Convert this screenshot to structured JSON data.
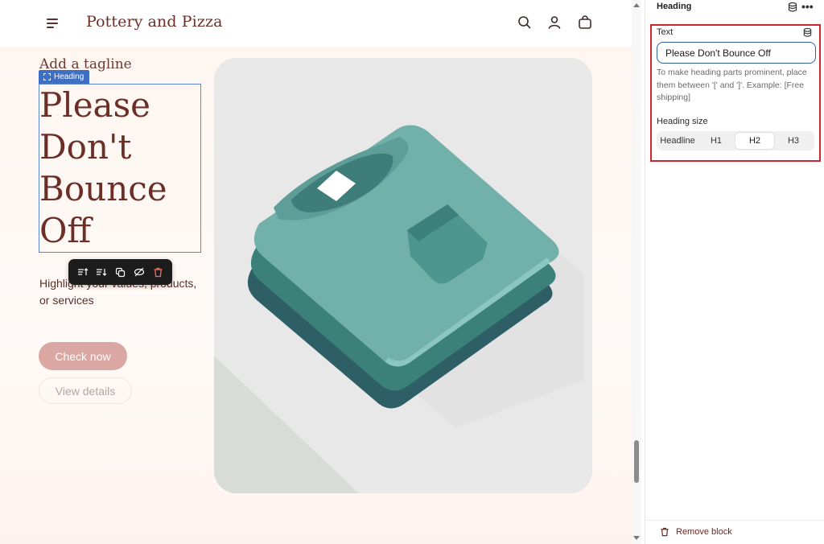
{
  "store": {
    "name": "Pottery and Pizza"
  },
  "hero": {
    "tagline": "Add a tagline",
    "heading_chip": "Heading",
    "heading": "Please Don't Bounce Off",
    "subtext": "Highlight your values, products, or services",
    "primary_button": "Check now",
    "secondary_button": "View details"
  },
  "panel": {
    "title": "Heading",
    "text_label": "Text",
    "text_value": "Please Don't Bounce Off",
    "help": "To make heading parts prominent, place them between '[' and ']'. Example: [Free shipping]",
    "size_label": "Heading size",
    "sizes": [
      "Headline",
      "H1",
      "H2",
      "H3"
    ],
    "active_size": "H2",
    "remove": "Remove block"
  },
  "colors": {
    "brand": "#6b2f28",
    "primary_button": "#dba7a2",
    "chip": "#3f6fc4",
    "highlight": "#c9262f",
    "shirt": "#72b0aa"
  },
  "icons": [
    "menu-icon",
    "search-icon",
    "account-icon",
    "cart-icon",
    "database-icon",
    "more-icon",
    "trash-icon",
    "duplicate-icon",
    "hide-icon",
    "move-icon"
  ]
}
